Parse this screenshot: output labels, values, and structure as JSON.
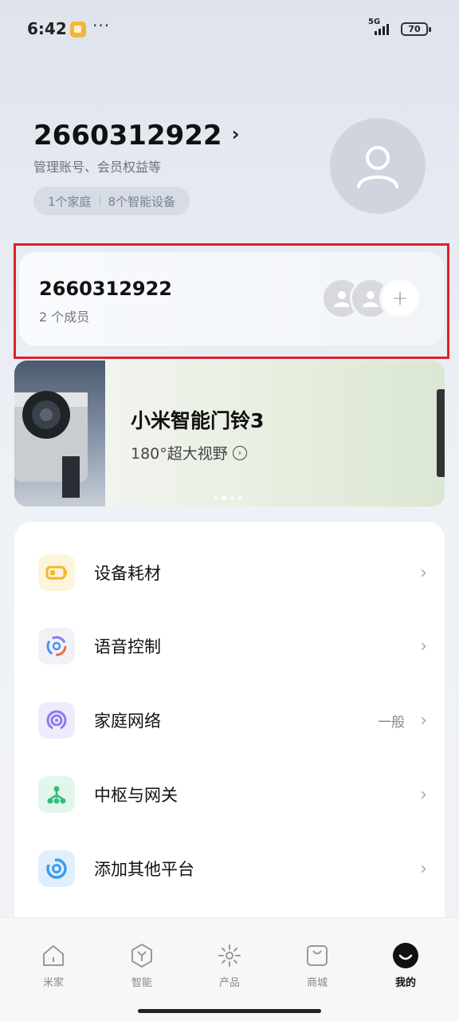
{
  "status_bar": {
    "time": "6:42",
    "more": "···",
    "network": "5G",
    "battery": "70"
  },
  "profile": {
    "account_id": "2660312922",
    "subtitle": "管理账号、会员权益等",
    "homes_count": "1个家庭",
    "devices_count": "8个智能设备"
  },
  "family_card": {
    "home_name": "2660312922",
    "members": "2 个成员",
    "add_icon": "+"
  },
  "banner": {
    "title": "小米智能门铃3",
    "subtitle": "180°超大视野",
    "arrow": "›"
  },
  "menu": {
    "items": [
      {
        "label": "设备耗材",
        "value": "",
        "icon": "battery-icon",
        "color": "#f4c43a"
      },
      {
        "label": "语音控制",
        "value": "",
        "icon": "voice-assistant-icon",
        "color": "#4e8ef5"
      },
      {
        "label": "家庭网络",
        "value": "一般",
        "icon": "wifi-signal-icon",
        "color": "#8a7af2"
      },
      {
        "label": "中枢与网关",
        "value": "",
        "icon": "hub-icon",
        "color": "#2ebf7a"
      },
      {
        "label": "添加其他平台",
        "value": "",
        "icon": "platform-icon",
        "color": "#3b9cf2"
      }
    ]
  },
  "tabs": [
    {
      "label": "米家",
      "icon": "home-icon"
    },
    {
      "label": "智能",
      "icon": "smart-icon"
    },
    {
      "label": "产品",
      "icon": "product-icon"
    },
    {
      "label": "商城",
      "icon": "shop-icon"
    },
    {
      "label": "我的",
      "icon": "profile-icon",
      "active": true
    }
  ]
}
